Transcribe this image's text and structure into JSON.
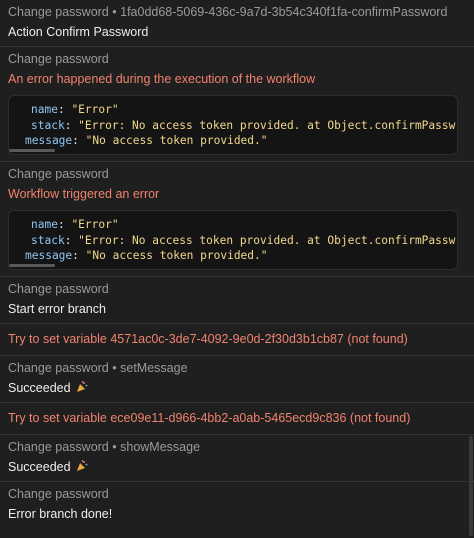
{
  "log": {
    "entries": [
      {
        "source": "Change password",
        "node": "1fa0dd68-5069-436c-9a7d-3b54c340f1fa-confirmPassword",
        "message": "Action Confirm Password"
      },
      {
        "source": "Change password",
        "message": "An error happened during the execution of the workflow",
        "error": {
          "name": "\"Error\"",
          "stack": "\"Error: No access token provided. at Object.confirmPassw",
          "message": "\"No access token provided.\""
        }
      },
      {
        "source": "Change password",
        "message": "Workflow triggered an error",
        "error": {
          "name": "\"Error\"",
          "stack": "\"Error: No access token provided. at Object.confirmPassw",
          "message": "\"No access token provided.\""
        }
      },
      {
        "source": "Change password",
        "message": "Start error branch"
      },
      {
        "message": "Try to set variable 4571ac0c-3de7-4092-9e0d-2f30d3b1cb87 (not found)"
      },
      {
        "source": "Change password",
        "node": "setMessage",
        "message": "Succeeded"
      },
      {
        "message": "Try to set variable ece09e11-d966-4bb2-a0ab-5465ecd9c836 (not found)"
      },
      {
        "source": "Change password",
        "node": "showMessage",
        "message": "Succeeded"
      },
      {
        "source": "Change password",
        "message": "Error branch done!"
      }
    ],
    "keys": {
      "name": "name",
      "stack": "stack",
      "message": "message"
    },
    "separator": "•"
  },
  "colors": {
    "background": "#1f1f1f",
    "error_text": "#f0826e",
    "code_key": "#8fc6f2",
    "code_string": "#f1d88c",
    "muted": "#9a9a9a"
  },
  "icons": {
    "party": "party-popper-icon"
  }
}
